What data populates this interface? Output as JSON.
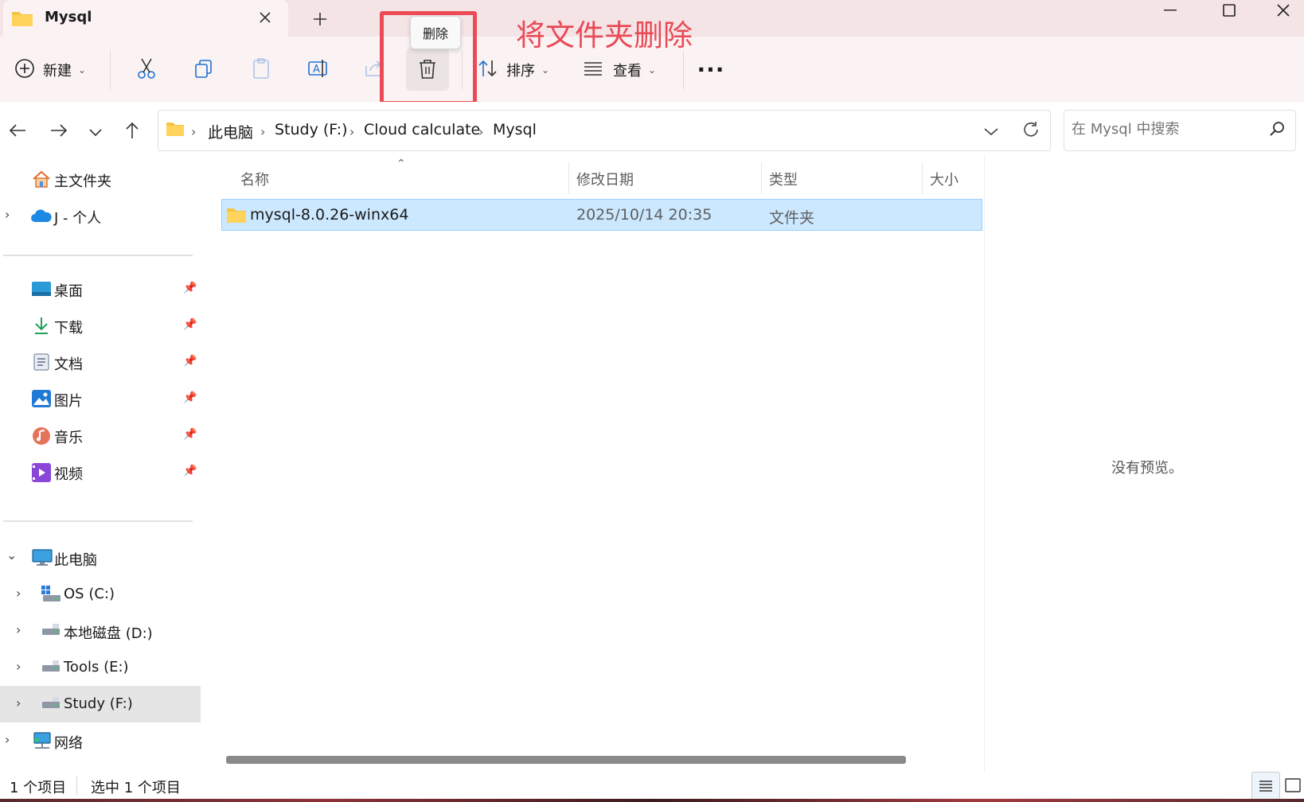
{
  "tab": {
    "title": "Mysql",
    "close_icon": "close-icon",
    "new_tab": "+"
  },
  "window_controls": [
    "minimize",
    "maximize",
    "close"
  ],
  "toolbar": {
    "new_label": "新建",
    "sort_label": "排序",
    "view_label": "查看",
    "more_label": "···",
    "tooltip": "删除"
  },
  "annotation": {
    "text": "将文件夹删除",
    "color": "#e94a56"
  },
  "address": {
    "crumbs": [
      "此电脑",
      "Study (F:)",
      "Cloud calculate",
      "Mysql"
    ]
  },
  "search": {
    "placeholder": "在 Mysql 中搜索"
  },
  "sidebar": {
    "home": "主文件夹",
    "cloud": "J - 个人",
    "pinned": [
      "桌面",
      "下载",
      "文档",
      "图片",
      "音乐",
      "视频"
    ],
    "this_pc": "此电脑",
    "drives": [
      "OS (C:)",
      "本地磁盘 (D:)",
      "Tools (E:)",
      "Study (F:)"
    ],
    "network": "网络"
  },
  "columns": {
    "name": "名称",
    "modified": "修改日期",
    "type": "类型",
    "size": "大小"
  },
  "files": [
    {
      "name": "mysql-8.0.26-winx64",
      "modified": "2025/10/14 20:35",
      "type": "文件夹",
      "size": ""
    }
  ],
  "preview": {
    "text": "没有预览。"
  },
  "status": {
    "count": "1 个项目",
    "selected": "选中 1 个项目"
  },
  "colors": {
    "selection": "#cce8ff",
    "titlebar": "#f5e4e6",
    "toolbar": "#fbf3f3",
    "folder": "#f5c542"
  }
}
